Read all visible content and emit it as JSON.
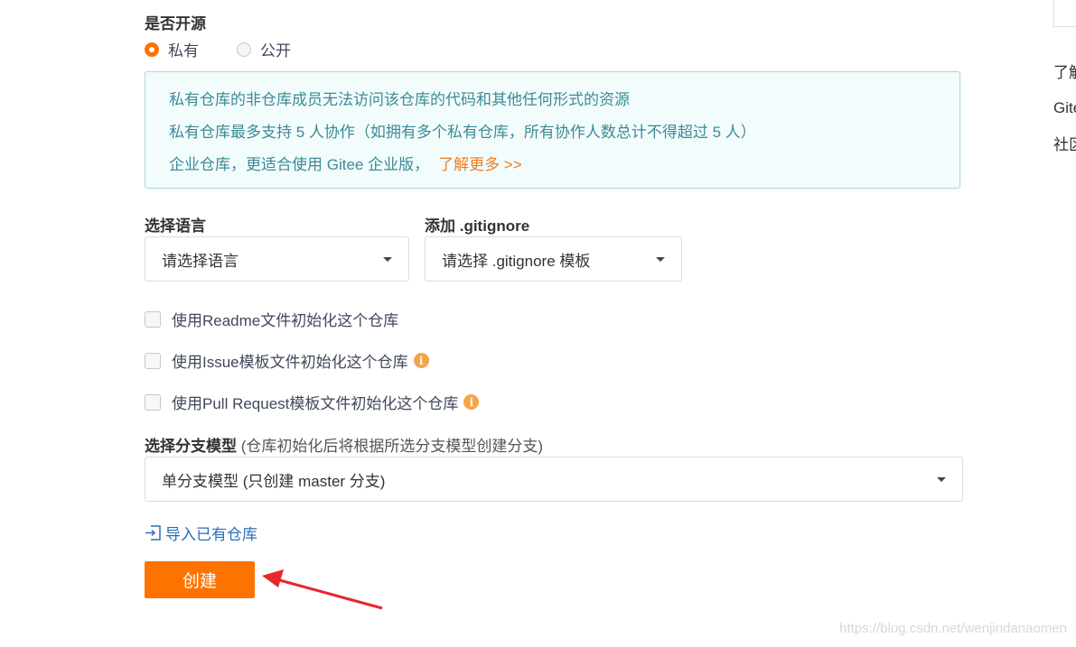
{
  "visibility": {
    "label": "是否开源",
    "options": [
      {
        "label": "私有",
        "checked": true
      },
      {
        "label": "公开",
        "checked": false
      }
    ]
  },
  "info_box": {
    "line1": "私有仓库的非仓库成员无法访问该仓库的代码和其他任何形式的资源",
    "line2": "私有仓库最多支持 5 人协作（如拥有多个私有仓库，所有协作人数总计不得超过 5 人）",
    "line3": "企业仓库，更适合使用 Gitee 企业版，",
    "link": "了解更多 >>"
  },
  "language": {
    "label": "选择语言",
    "placeholder": "请选择语言"
  },
  "gitignore": {
    "label": "添加 .gitignore",
    "placeholder": "请选择 .gitignore 模板"
  },
  "init_options": [
    {
      "label": "使用Readme文件初始化这个仓库",
      "checked": false,
      "info": false
    },
    {
      "label": "使用Issue模板文件初始化这个仓库",
      "checked": false,
      "info": true
    },
    {
      "label": "使用Pull Request模板文件初始化这个仓库",
      "checked": false,
      "info": true
    }
  ],
  "branch_model": {
    "label": "选择分支模型",
    "hint": "(仓库初始化后将根据所选分支模型创建分支)",
    "value": "单分支模型 (只创建 master 分支)"
  },
  "import_link": "导入已有仓库",
  "create_button": "创建",
  "right_panel": {
    "text1": "了解",
    "text2": "Gite",
    "text3": "社区"
  },
  "watermark": "https://blog.csdn.net/wenjindanaomen",
  "colors": {
    "accent": "#fe7300",
    "info_text": "#3d8a95",
    "info_bg": "#f2fcfd"
  }
}
